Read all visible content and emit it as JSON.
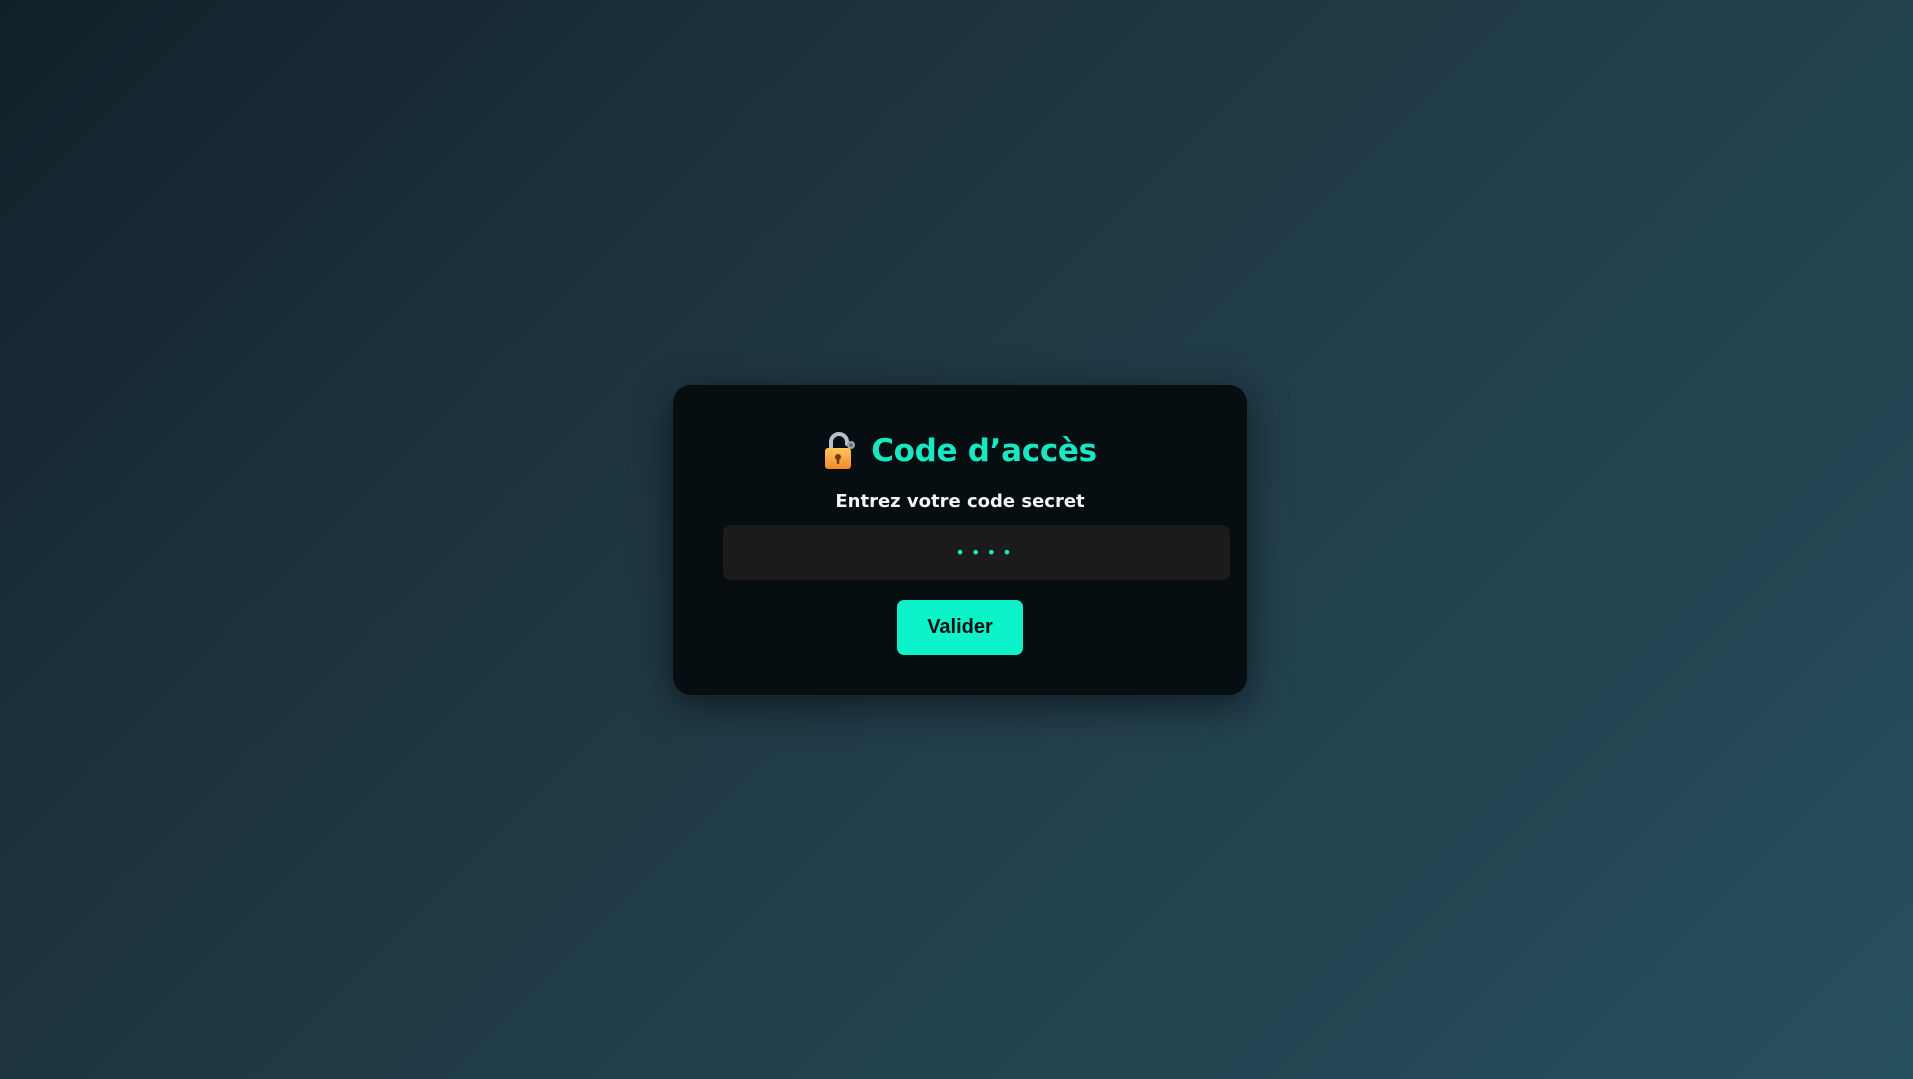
{
  "login": {
    "title": "Code d’accès",
    "title_icon": "lock-icon",
    "prompt": "Entrez votre code secret",
    "code_value": "••••",
    "submit_label": "Valider"
  },
  "colors": {
    "accent": "#18e8c1",
    "button": "#0cf3c9",
    "card_background": "#070e11",
    "input_background": "#1b1b1c",
    "label_text": "#f2f4f5"
  }
}
